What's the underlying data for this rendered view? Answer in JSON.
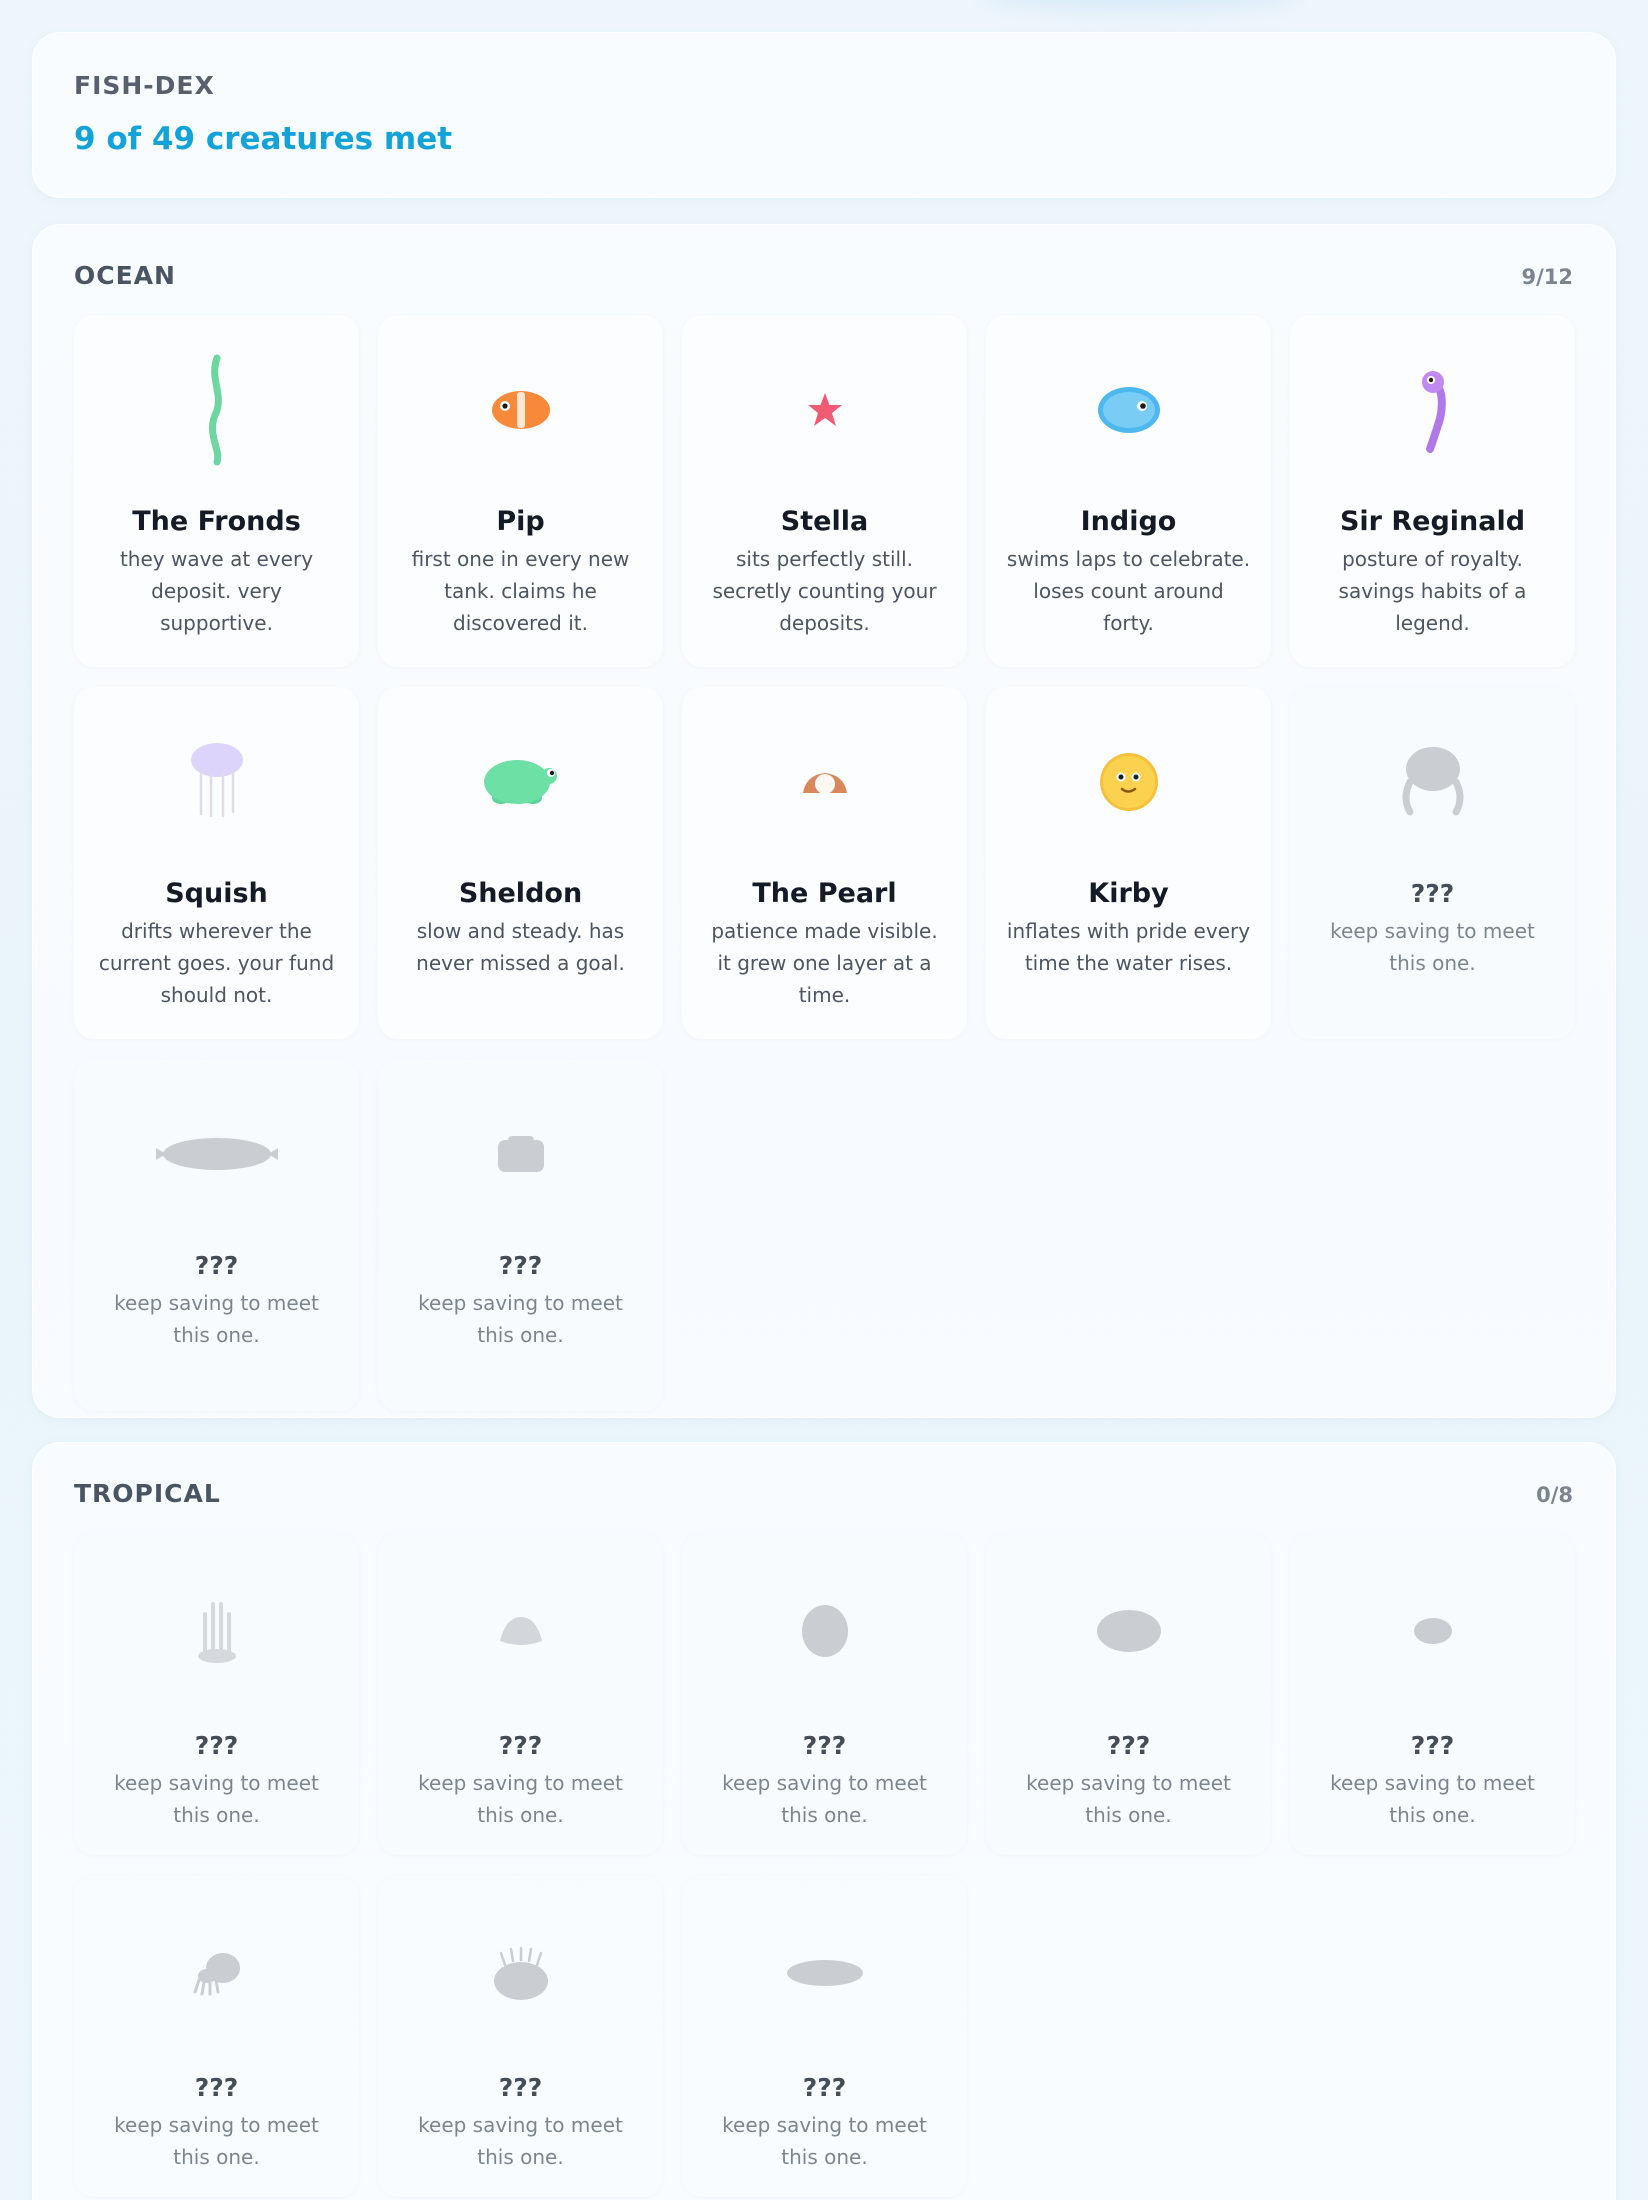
{
  "header": {
    "eyebrow": "FISH-DEX",
    "progress": "9 of 49 creatures met"
  },
  "colors": {
    "accent": "#13a3d8",
    "locked_silhouette": "#c9ccd1"
  },
  "ocean": {
    "title": "OCEAN",
    "count": "9/12",
    "creatures": [
      {
        "name": "The Fronds",
        "desc": "they wave at every deposit. very supportive.",
        "icon": "seaweed-icon",
        "locked": false
      },
      {
        "name": "Pip",
        "desc": "first one in every new tank. claims he discovered it.",
        "icon": "clownfish-icon",
        "locked": false
      },
      {
        "name": "Stella",
        "desc": "sits perfectly still. secretly counting your deposits.",
        "icon": "starfish-icon",
        "locked": false
      },
      {
        "name": "Indigo",
        "desc": "swims laps to celebrate. loses count around forty.",
        "icon": "blue-fish-icon",
        "locked": false
      },
      {
        "name": "Sir Reginald",
        "desc": "posture of royalty. savings habits of a legend.",
        "icon": "seahorse-icon",
        "locked": false
      },
      {
        "name": "Squish",
        "desc": "drifts wherever the current goes. your fund should not.",
        "icon": "jellyfish-icon",
        "locked": false
      },
      {
        "name": "Sheldon",
        "desc": "slow and steady. has never missed a goal.",
        "icon": "turtle-icon",
        "locked": false
      },
      {
        "name": "The Pearl",
        "desc": "patience made visible. it grew one layer at a time.",
        "icon": "pearl-clam-icon",
        "locked": false
      },
      {
        "name": "Kirby",
        "desc": "inflates with pride every time the water rises.",
        "icon": "pufferfish-icon",
        "locked": false
      },
      {
        "name": "???",
        "desc": "keep saving to meet this one.",
        "icon": "octopus-silhouette-icon",
        "locked": true
      },
      {
        "name": "???",
        "desc": "keep saving to meet this one.",
        "icon": "whale-silhouette-icon",
        "locked": true
      },
      {
        "name": "???",
        "desc": "keep saving to meet this one.",
        "icon": "crab-silhouette-icon",
        "locked": true
      }
    ]
  },
  "tropical": {
    "title": "TROPICAL",
    "count": "0/8",
    "creatures": [
      {
        "name": "???",
        "desc": "keep saving to meet this one.",
        "icon": "anemone-silhouette-icon",
        "locked": true
      },
      {
        "name": "???",
        "desc": "keep saving to meet this one.",
        "icon": "shell-silhouette-icon",
        "locked": true
      },
      {
        "name": "???",
        "desc": "keep saving to meet this one.",
        "icon": "egg-fish-silhouette-icon",
        "locked": true
      },
      {
        "name": "???",
        "desc": "keep saving to meet this one.",
        "icon": "oval-fish-silhouette-icon",
        "locked": true
      },
      {
        "name": "???",
        "desc": "keep saving to meet this one.",
        "icon": "small-fish-silhouette-icon",
        "locked": true
      },
      {
        "name": "???",
        "desc": "keep saving to meet this one.",
        "icon": "squid-silhouette-icon",
        "locked": true
      },
      {
        "name": "???",
        "desc": "keep saving to meet this one.",
        "icon": "urchin-silhouette-icon",
        "locked": true
      },
      {
        "name": "???",
        "desc": "keep saving to meet this one.",
        "icon": "eel-silhouette-icon",
        "locked": true
      }
    ]
  }
}
